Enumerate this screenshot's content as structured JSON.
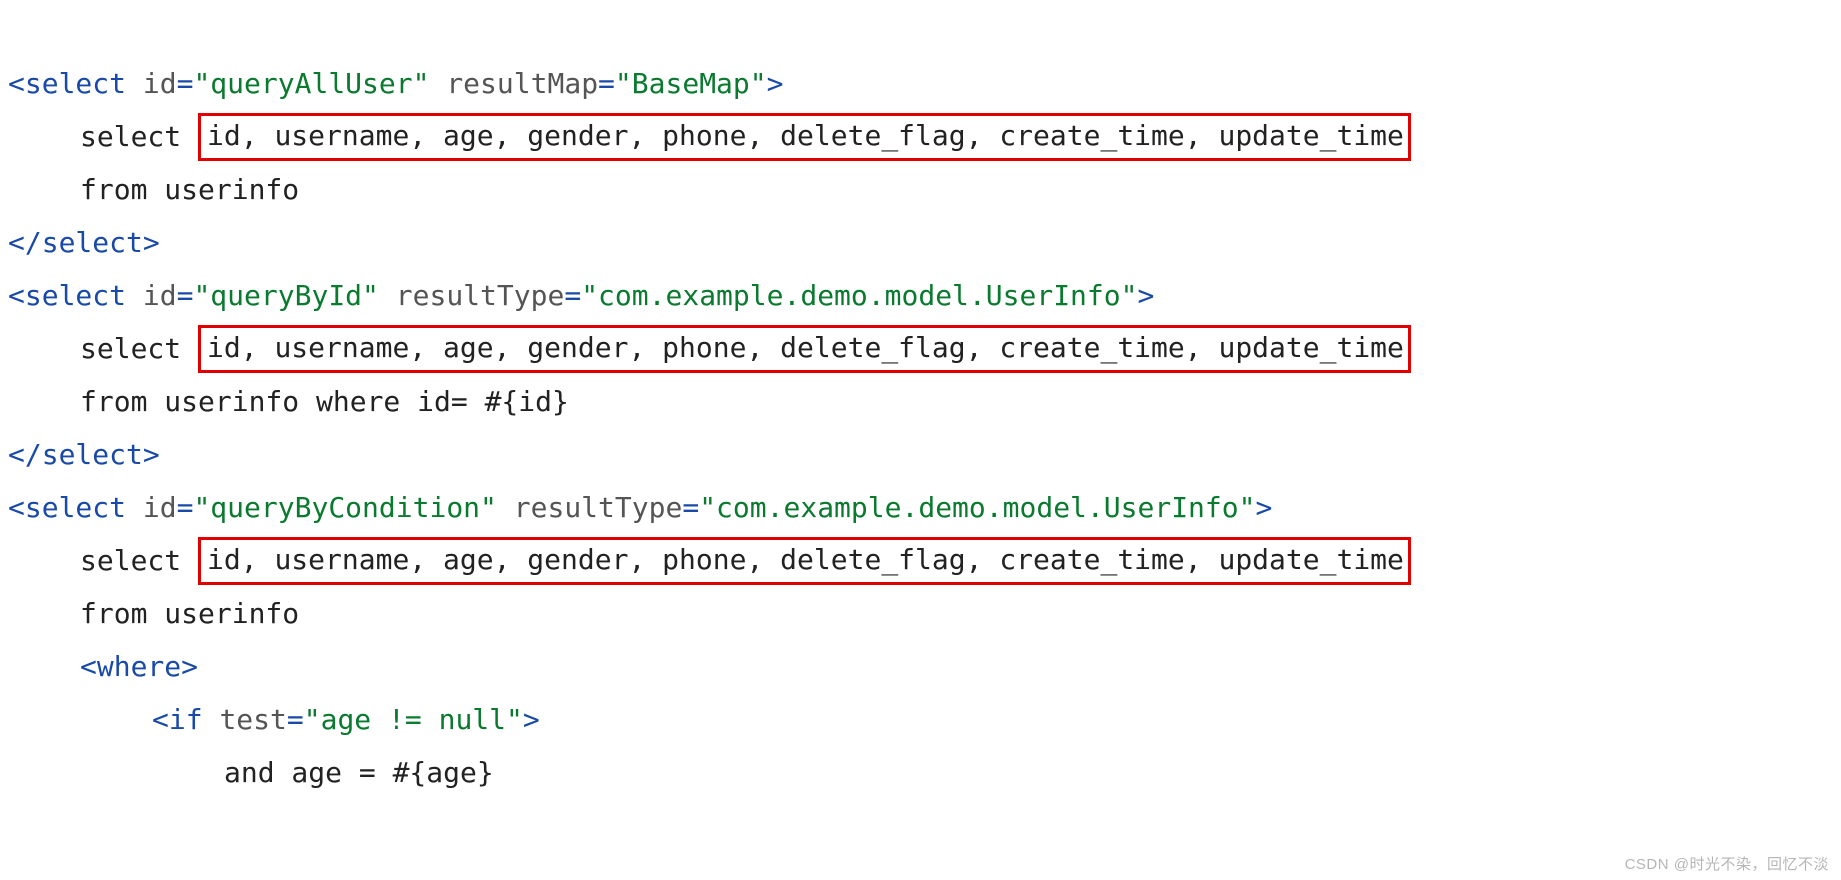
{
  "code": {
    "select1": {
      "open_lt": "<",
      "tag": "select",
      "sp": " ",
      "attr_id": "id",
      "eq": "=",
      "val_id": "\"queryAllUser\"",
      "attr_rm": "resultMap",
      "val_rm": "\"BaseMap\"",
      "open_gt": ">",
      "body_select": "select ",
      "body_cols": "id, username, age, gender, phone, delete_flag, create_time, update_time",
      "body_from": "from userinfo",
      "close": "</",
      "close_gt": ">"
    },
    "select2": {
      "open_lt": "<",
      "tag": "select",
      "sp": " ",
      "attr_id": "id",
      "eq": "=",
      "val_id": "\"queryById\"",
      "attr_rt": "resultType",
      "val_rt": "\"com.example.demo.model.UserInfo\"",
      "open_gt": ">",
      "body_select": "select ",
      "body_cols": "id, username, age, gender, phone, delete_flag, create_time, update_time",
      "body_from": "from userinfo where id= #{id}",
      "close": "</",
      "close_gt": ">"
    },
    "select3": {
      "open_lt": "<",
      "tag": "select",
      "sp": " ",
      "attr_id": "id",
      "eq": "=",
      "val_id": "\"queryByCondition\"",
      "attr_rt": "resultType",
      "val_rt": "\"com.example.demo.model.UserInfo\"",
      "open_gt": ">",
      "body_select": "select ",
      "body_cols": "id, username, age, gender, phone, delete_flag, create_time, update_time",
      "body_from": "from userinfo",
      "where_open_lt": "<",
      "where_tag": "where",
      "where_open_gt": ">",
      "if_open_lt": "<",
      "if_tag": "if",
      "if_attr": "test",
      "if_val": "\"age != null\"",
      "if_open_gt": ">",
      "if_body": "and age = #{age}"
    }
  },
  "watermark": "CSDN @时光不染，回忆不淡"
}
